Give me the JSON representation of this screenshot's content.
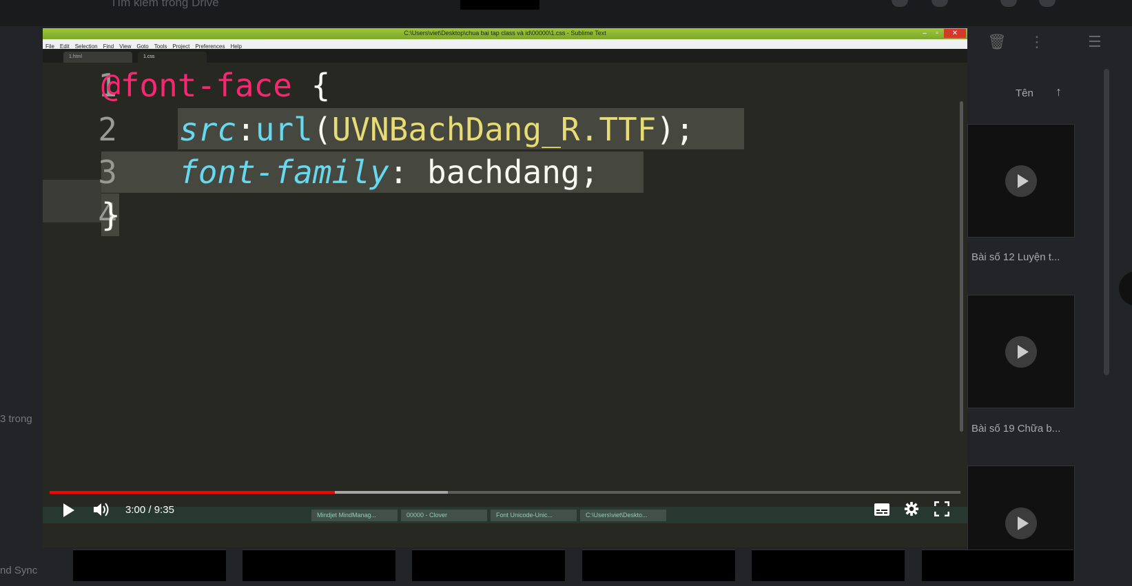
{
  "drive": {
    "search_placeholder": "Tìm kiếm trong Drive",
    "sort_label": "Tên",
    "left_fragments": [
      "3 trong",
      "nd Sync"
    ],
    "captions": [
      "Bài số 12 Luyện t...",
      "Bài số 19 Chữa b..."
    ]
  },
  "editor": {
    "window_title": "C:\\Users\\viet\\Desktop\\chua bai tap class và id\\00000\\1.css - Sublime Text",
    "menu": [
      "File",
      "Edit",
      "Selection",
      "Find",
      "View",
      "Goto",
      "Tools",
      "Project",
      "Preferences",
      "Help"
    ],
    "tabs": [
      "1.html",
      "1.css"
    ],
    "line_numbers": [
      "1",
      "2",
      "3",
      "4"
    ],
    "code": {
      "l1_at": "@font-face",
      "l1_brace": " {",
      "l2_prop": "src",
      "l2_colon": ":",
      "l2_func": "url",
      "l2_open": "(",
      "l2_arg": "UVNBachDang_R.TTF",
      "l2_close": ");",
      "l3_prop": "font-family",
      "l3_rest": ": bachdang;",
      "l4": "}"
    },
    "taskbar_items": [
      "Mindjet MindManag...",
      "00000 - Clover",
      "Font Unicode-Unic...",
      "C:\\Users\\viet\\Deskto..."
    ]
  },
  "player": {
    "time_current": "3:00",
    "time_separator": " / ",
    "time_total": "9:35",
    "played_fraction": 0.313,
    "buffered_fraction": 0.437,
    "progress_color": "#ff0000",
    "icons": [
      "play-icon",
      "volume-icon",
      "subtitles-icon",
      "settings-icon",
      "fullscreen-icon"
    ]
  }
}
